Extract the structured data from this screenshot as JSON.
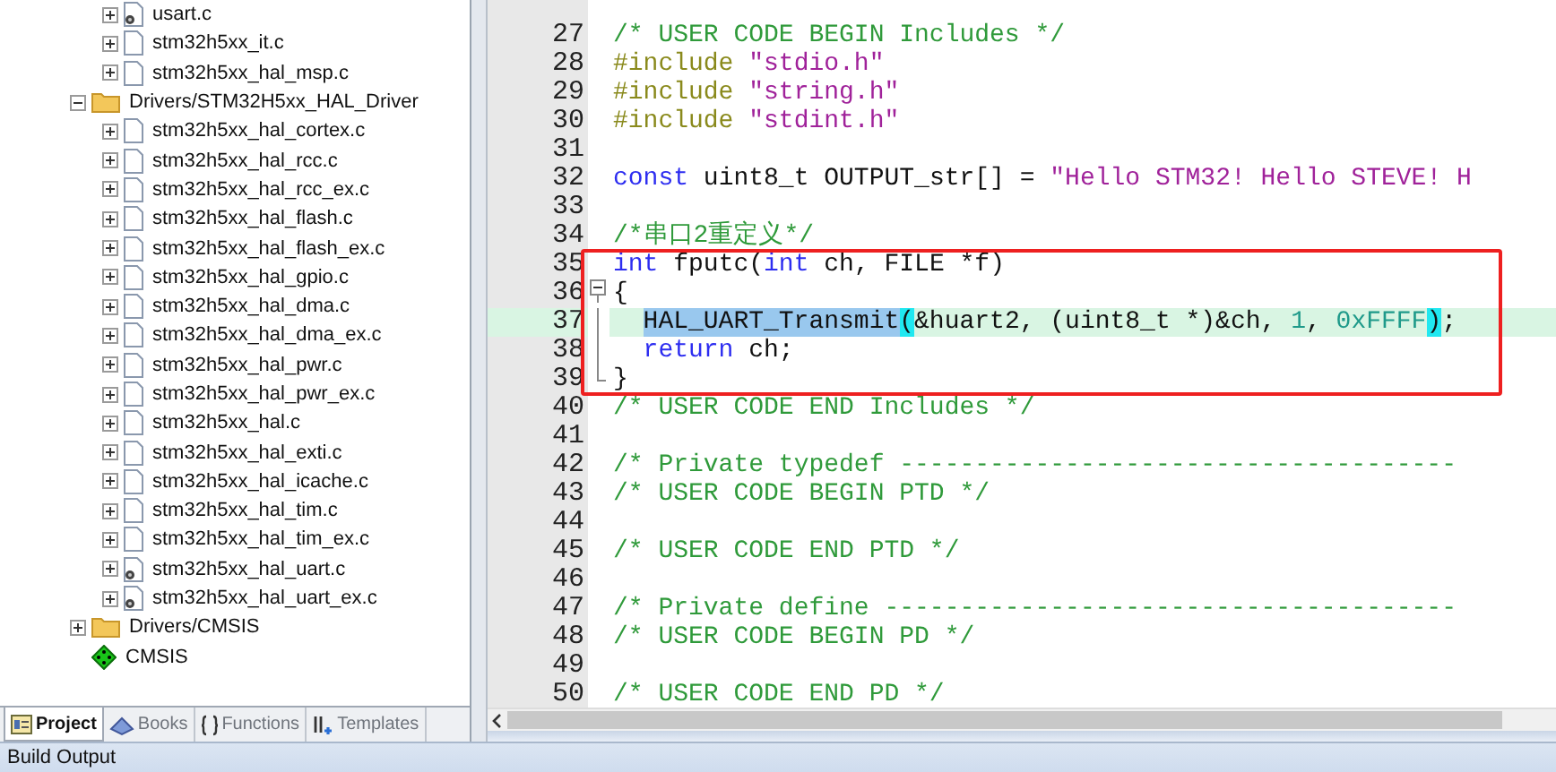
{
  "project_tree": {
    "items": [
      {
        "label": "usart.c",
        "kind": "file-gear",
        "expanded": false
      },
      {
        "label": "stm32h5xx_it.c",
        "kind": "file",
        "expanded": false
      },
      {
        "label": "stm32h5xx_hal_msp.c",
        "kind": "file",
        "expanded": false
      },
      {
        "label": "Drivers/STM32H5xx_HAL_Driver",
        "kind": "folder",
        "expanded": true,
        "children": [
          {
            "label": "stm32h5xx_hal_cortex.c",
            "kind": "file",
            "expanded": false
          },
          {
            "label": "stm32h5xx_hal_rcc.c",
            "kind": "file",
            "expanded": false
          },
          {
            "label": "stm32h5xx_hal_rcc_ex.c",
            "kind": "file",
            "expanded": false
          },
          {
            "label": "stm32h5xx_hal_flash.c",
            "kind": "file",
            "expanded": false
          },
          {
            "label": "stm32h5xx_hal_flash_ex.c",
            "kind": "file",
            "expanded": false
          },
          {
            "label": "stm32h5xx_hal_gpio.c",
            "kind": "file",
            "expanded": false
          },
          {
            "label": "stm32h5xx_hal_dma.c",
            "kind": "file",
            "expanded": false
          },
          {
            "label": "stm32h5xx_hal_dma_ex.c",
            "kind": "file",
            "expanded": false
          },
          {
            "label": "stm32h5xx_hal_pwr.c",
            "kind": "file",
            "expanded": false
          },
          {
            "label": "stm32h5xx_hal_pwr_ex.c",
            "kind": "file",
            "expanded": false
          },
          {
            "label": "stm32h5xx_hal.c",
            "kind": "file",
            "expanded": false
          },
          {
            "label": "stm32h5xx_hal_exti.c",
            "kind": "file",
            "expanded": false
          },
          {
            "label": "stm32h5xx_hal_icache.c",
            "kind": "file",
            "expanded": false
          },
          {
            "label": "stm32h5xx_hal_tim.c",
            "kind": "file",
            "expanded": false
          },
          {
            "label": "stm32h5xx_hal_tim_ex.c",
            "kind": "file",
            "expanded": false
          },
          {
            "label": "stm32h5xx_hal_uart.c",
            "kind": "file-gear",
            "expanded": false
          },
          {
            "label": "stm32h5xx_hal_uart_ex.c",
            "kind": "file-gear",
            "expanded": false
          }
        ]
      },
      {
        "label": "Drivers/CMSIS",
        "kind": "folder",
        "expanded": false
      },
      {
        "label": "CMSIS",
        "kind": "component"
      }
    ]
  },
  "panel_tabs": [
    {
      "label": "Project",
      "kind": "project",
      "selected": true
    },
    {
      "label": "Books",
      "kind": "books",
      "selected": false
    },
    {
      "label": "Functions",
      "kind": "functions",
      "selected": false
    },
    {
      "label": "Templates",
      "kind": "templates",
      "selected": false
    }
  ],
  "editor": {
    "lines": [
      {
        "number": "27",
        "boxed": false,
        "highlighted": false,
        "tokens": [
          {
            "kind": "comment",
            "text": "/* USER CODE BEGIN Includes */"
          }
        ]
      },
      {
        "number": "28",
        "boxed": false,
        "highlighted": false,
        "tokens": [
          {
            "kind": "preproc",
            "text": "#include "
          },
          {
            "kind": "string",
            "text": "\"stdio.h\""
          }
        ]
      },
      {
        "number": "29",
        "boxed": false,
        "highlighted": false,
        "tokens": [
          {
            "kind": "preproc",
            "text": "#include "
          },
          {
            "kind": "string",
            "text": "\"string.h\""
          }
        ]
      },
      {
        "number": "30",
        "boxed": false,
        "highlighted": false,
        "tokens": [
          {
            "kind": "preproc",
            "text": "#include "
          },
          {
            "kind": "string",
            "text": "\"stdint.h\""
          }
        ]
      },
      {
        "number": "31",
        "boxed": false,
        "highlighted": false
      },
      {
        "number": "32",
        "boxed": false,
        "highlighted": false,
        "tokens": [
          {
            "kind": "keyword",
            "text": "const"
          },
          {
            "kind": "plain",
            "text": " uint8_t OUTPUT_str[] = "
          },
          {
            "kind": "string",
            "text": "\"Hello STM32! Hello STEVE! H"
          }
        ]
      },
      {
        "number": "33",
        "boxed": false,
        "highlighted": false
      },
      {
        "number": "34",
        "boxed": false,
        "highlighted": false,
        "tokens": [
          {
            "kind": "comment",
            "text": "/*串口2重定义*/"
          }
        ]
      },
      {
        "number": "35",
        "boxed": true,
        "highlighted": false,
        "tokens": [
          {
            "kind": "keyword",
            "text": "int"
          },
          {
            "kind": "plain",
            "text": " fputc("
          },
          {
            "kind": "keyword",
            "text": "int"
          },
          {
            "kind": "plain",
            "text": " ch, FILE *f)"
          }
        ]
      },
      {
        "number": "36",
        "boxed": true,
        "highlighted": false,
        "fold_open": true,
        "tokens": [
          {
            "kind": "plain",
            "text": "{"
          }
        ]
      },
      {
        "number": "37",
        "boxed": true,
        "highlighted": true,
        "fold_body": true,
        "indented": true,
        "tokens": [
          {
            "kind": "selected",
            "text": "HAL_UART_Transmit"
          },
          {
            "kind": "bracket",
            "text": "("
          },
          {
            "kind": "plain",
            "text": "&huart2, (uint8_t *)&ch, "
          },
          {
            "kind": "number",
            "text": "1"
          },
          {
            "kind": "plain",
            "text": ", "
          },
          {
            "kind": "number",
            "text": "0xFFFF"
          },
          {
            "kind": "bracket",
            "text": ")"
          },
          {
            "kind": "plain",
            "text": ";"
          }
        ]
      },
      {
        "number": "38",
        "boxed": true,
        "highlighted": false,
        "fold_body": true,
        "indented": true,
        "tokens": [
          {
            "kind": "keyword",
            "text": "return"
          },
          {
            "kind": "plain",
            "text": " ch;"
          }
        ]
      },
      {
        "number": "39",
        "boxed": true,
        "highlighted": false,
        "fold_end": true,
        "tokens": [
          {
            "kind": "plain",
            "text": "}"
          }
        ]
      },
      {
        "number": "40",
        "boxed": false,
        "highlighted": false,
        "tokens": [
          {
            "kind": "comment",
            "text": "/* USER CODE END Includes */"
          }
        ]
      },
      {
        "number": "41",
        "boxed": false,
        "highlighted": false
      },
      {
        "number": "42",
        "boxed": false,
        "highlighted": false,
        "tokens": [
          {
            "kind": "comment",
            "text": "/* Private typedef -------------------------------------"
          }
        ]
      },
      {
        "number": "43",
        "boxed": false,
        "highlighted": false,
        "tokens": [
          {
            "kind": "comment",
            "text": "/* USER CODE BEGIN PTD */"
          }
        ]
      },
      {
        "number": "44",
        "boxed": false,
        "highlighted": false
      },
      {
        "number": "45",
        "boxed": false,
        "highlighted": false,
        "tokens": [
          {
            "kind": "comment",
            "text": "/* USER CODE END PTD */"
          }
        ]
      },
      {
        "number": "46",
        "boxed": false,
        "highlighted": false
      },
      {
        "number": "47",
        "boxed": false,
        "highlighted": false,
        "tokens": [
          {
            "kind": "comment",
            "text": "/* Private define --------------------------------------"
          }
        ]
      },
      {
        "number": "48",
        "boxed": false,
        "highlighted": false,
        "tokens": [
          {
            "kind": "comment",
            "text": "/* USER CODE BEGIN PD */"
          }
        ]
      },
      {
        "number": "49",
        "boxed": false,
        "highlighted": false
      },
      {
        "number": "50",
        "boxed": false,
        "highlighted": false,
        "tokens": [
          {
            "kind": "comment",
            "text": "/* USER CODE END PD */"
          }
        ]
      }
    ]
  },
  "build_output": {
    "title": "Build Output"
  }
}
